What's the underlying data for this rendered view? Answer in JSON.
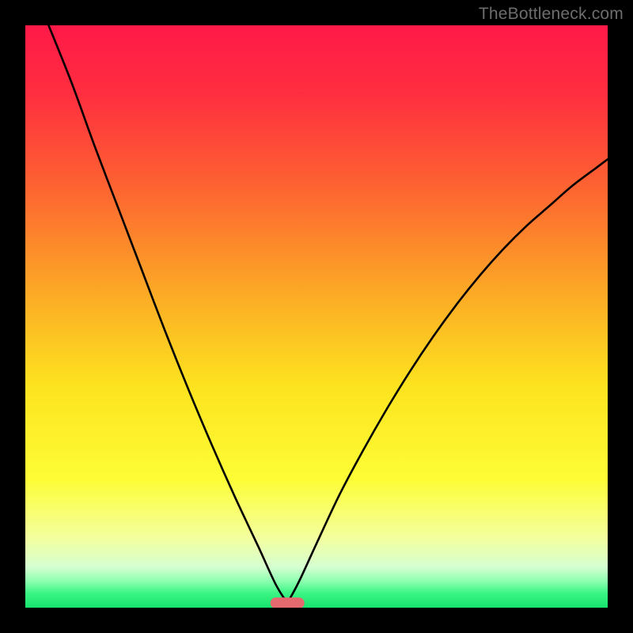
{
  "watermark": "TheBottleneck.com",
  "colors": {
    "background": "#000000",
    "curve": "#000000",
    "marker_fill": "#e46a6f",
    "marker_stroke": "#e46a6f",
    "gradient_stops": [
      {
        "offset": 0.0,
        "color": "#ff1948"
      },
      {
        "offset": 0.12,
        "color": "#ff2f3f"
      },
      {
        "offset": 0.28,
        "color": "#fd6431"
      },
      {
        "offset": 0.45,
        "color": "#fca626"
      },
      {
        "offset": 0.62,
        "color": "#fde31f"
      },
      {
        "offset": 0.78,
        "color": "#fdfd36"
      },
      {
        "offset": 0.88,
        "color": "#f3ff9e"
      },
      {
        "offset": 0.93,
        "color": "#d6ffd1"
      },
      {
        "offset": 0.955,
        "color": "#8bffaf"
      },
      {
        "offset": 0.975,
        "color": "#3bf584"
      },
      {
        "offset": 1.0,
        "color": "#17e36e"
      }
    ]
  },
  "chart_data": {
    "type": "line",
    "title": "",
    "xlabel": "",
    "ylabel": "",
    "xlim": [
      0,
      100
    ],
    "ylim": [
      0,
      100
    ],
    "grid": false,
    "legend": false,
    "minimum_marker": {
      "x": 45,
      "y": 0.8
    },
    "series": [
      {
        "name": "left-branch",
        "x": [
          4,
          8,
          12,
          16,
          20,
          24,
          28,
          32,
          36,
          40,
          43,
          45
        ],
        "values": [
          100,
          90,
          79,
          68.5,
          58,
          47.5,
          37.5,
          28,
          19,
          10.5,
          4,
          0.8
        ]
      },
      {
        "name": "right-branch",
        "x": [
          45,
          47,
          50,
          54,
          58,
          62,
          66,
          70,
          74,
          78,
          82,
          86,
          90,
          94,
          98,
          100
        ],
        "values": [
          0.8,
          4.5,
          11,
          19.5,
          27,
          34,
          40.5,
          46.5,
          52,
          57,
          61.5,
          65.5,
          69,
          72.5,
          75.5,
          77
        ]
      }
    ]
  }
}
